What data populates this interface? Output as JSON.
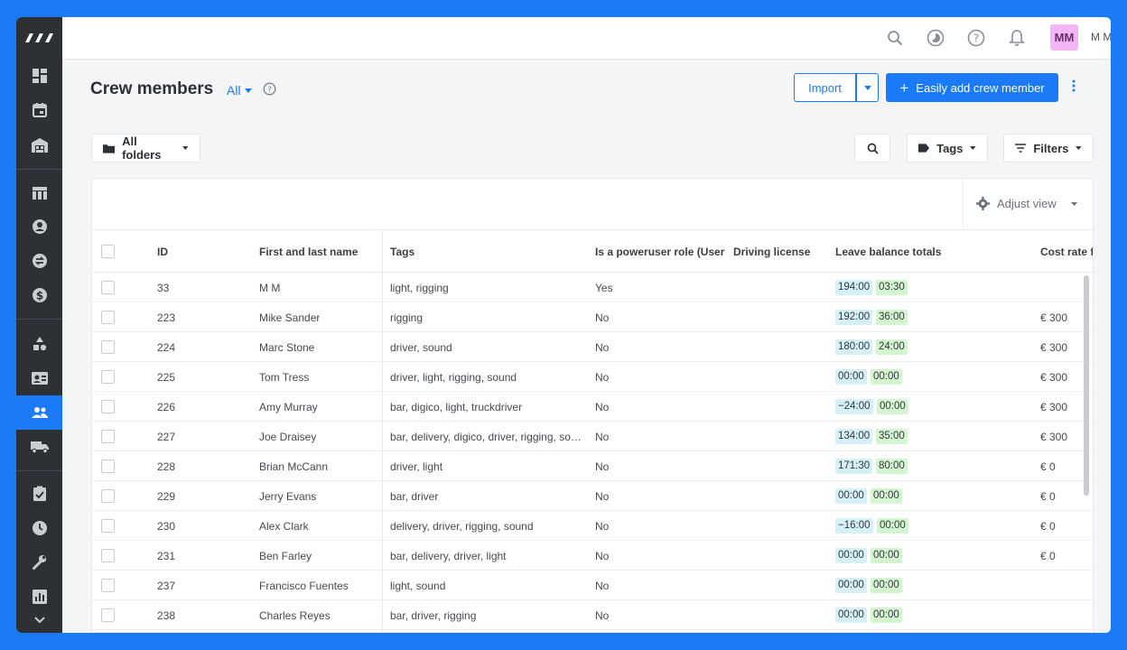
{
  "app": {
    "user_initials": "MM",
    "user_name": "M M"
  },
  "page": {
    "title": "Crew members",
    "view_filter": "All",
    "import_label": "Import",
    "add_label": "Easily add crew member",
    "folders_label": "All folders",
    "tags_label": "Tags",
    "filters_label": "Filters",
    "adjust_view_label": "Adjust view"
  },
  "table": {
    "columns": [
      "ID",
      "First and last name",
      "Tags",
      "Is a poweruser role (User ro",
      "Driving license",
      "Leave balance totals",
      "Cost rate fi"
    ],
    "rows": [
      {
        "id": "33",
        "name": "M M",
        "tags": "light, rigging",
        "poweruser": "Yes",
        "leave1": "194:00",
        "leave2": "03:30",
        "cost": ""
      },
      {
        "id": "223",
        "name": "Mike Sander",
        "tags": "rigging",
        "poweruser": "No",
        "leave1": "192:00",
        "leave2": "36:00",
        "cost": "€ 300"
      },
      {
        "id": "224",
        "name": "Marc Stone",
        "tags": "driver, sound",
        "poweruser": "No",
        "leave1": "180:00",
        "leave2": "24:00",
        "cost": "€ 300"
      },
      {
        "id": "225",
        "name": "Tom Tress",
        "tags": "driver, light, rigging, sound",
        "poweruser": "No",
        "leave1": "00:00",
        "leave2": "00:00",
        "cost": "€ 300"
      },
      {
        "id": "226",
        "name": "Amy Murray",
        "tags": "bar, digico, light, truckdriver",
        "poweruser": "No",
        "leave1": "−24:00",
        "leave2": "00:00",
        "cost": "€ 300"
      },
      {
        "id": "227",
        "name": "Joe Draisey",
        "tags": "bar, delivery, digico, driver, rigging, sou…",
        "poweruser": "No",
        "leave1": "134:00",
        "leave2": "35:00",
        "cost": "€ 300"
      },
      {
        "id": "228",
        "name": "Brian McCann",
        "tags": "driver, light",
        "poweruser": "No",
        "leave1": "171:30",
        "leave2": "80:00",
        "cost": "€ 0"
      },
      {
        "id": "229",
        "name": "Jerry Evans",
        "tags": "bar, driver",
        "poweruser": "No",
        "leave1": "00:00",
        "leave2": "00:00",
        "cost": "€ 0"
      },
      {
        "id": "230",
        "name": "Alex Clark",
        "tags": "delivery, driver, rigging, sound",
        "poweruser": "No",
        "leave1": "−16:00",
        "leave2": "00:00",
        "cost": "€ 0"
      },
      {
        "id": "231",
        "name": "Ben Farley",
        "tags": "bar, delivery, driver, light",
        "poweruser": "No",
        "leave1": "00:00",
        "leave2": "00:00",
        "cost": "€ 0"
      },
      {
        "id": "237",
        "name": "Francisco Fuentes",
        "tags": "light, sound",
        "poweruser": "No",
        "leave1": "00:00",
        "leave2": "00:00",
        "cost": ""
      },
      {
        "id": "238",
        "name": "Charles Reyes",
        "tags": "bar, driver, rigging",
        "poweruser": "No",
        "leave1": "00:00",
        "leave2": "00:00",
        "cost": ""
      }
    ]
  },
  "sidebar": {
    "icons": [
      "dashboard-icon",
      "calendar-icon",
      "warehouse-icon",
      "table-icon",
      "contacts-icon",
      "exchange-icon",
      "dollar-icon",
      "shapes-icon",
      "id-card-icon",
      "crew-icon",
      "truck-icon",
      "clipboard-check-icon",
      "clock-icon",
      "wrench-icon",
      "reports-icon",
      "chevron-down-icon"
    ],
    "active": "crew-icon"
  },
  "colors": {
    "accent": "#1a7af8",
    "sidebar": "#2d3035",
    "avatar": "#f2b6f4",
    "pill_blue": "#d6f0f7",
    "pill_green": "#d3f5d0"
  }
}
